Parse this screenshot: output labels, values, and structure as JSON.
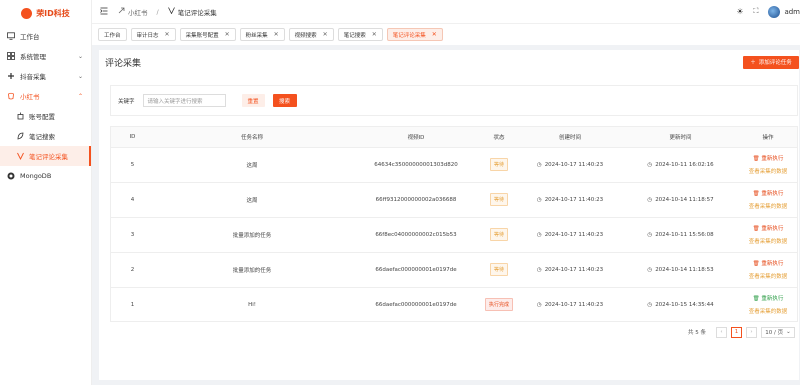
{
  "app": {
    "logo_text": "荣ID科技"
  },
  "sidebar": {
    "items": [
      {
        "label": "工作台",
        "icon": "monitor-icon"
      },
      {
        "label": "系统管理",
        "icon": "grid-icon"
      },
      {
        "label": "抖音采集",
        "icon": "tiktok-icon"
      },
      {
        "label": "小红书",
        "icon": "redbook-icon"
      }
    ],
    "sub_items": [
      {
        "label": "账号配置"
      },
      {
        "label": "笔记搜索"
      },
      {
        "label": "笔记评论采集"
      }
    ],
    "mongo": {
      "label": "MongoDB"
    }
  },
  "header": {
    "breadcrumb": [
      "小红书",
      "笔记评论采集"
    ],
    "username": "adm"
  },
  "tags": [
    {
      "label": "工作台"
    },
    {
      "label": "审计日志"
    },
    {
      "label": "采集账号配置"
    },
    {
      "label": "粉丝采集"
    },
    {
      "label": "视频搜索"
    },
    {
      "label": "笔记搜索"
    },
    {
      "label": "笔记评论采集"
    }
  ],
  "page": {
    "title": "评论采集",
    "add_button": "添加评论任务",
    "search_label": "关键字",
    "search_placeholder": "请输入关键字进行搜索",
    "reset_button": "重置",
    "search_button": "搜索"
  },
  "table": {
    "headers": [
      "ID",
      "任务名称",
      "视频ID",
      "状态",
      "创建时间",
      "更新时间",
      "操作"
    ],
    "rows": [
      {
        "id": "5",
        "name": "这周",
        "video_id": "64634c35000000001303d820",
        "status": "等待",
        "created": "2024-10-17 11:40:23",
        "updated": "2024-10-11 16:02:16",
        "op1": "重新执行",
        "op2": "查看采集的数据"
      },
      {
        "id": "4",
        "name": "这周",
        "video_id": "66ff9312000000002a036688",
        "status": "等待",
        "created": "2024-10-17 11:40:23",
        "updated": "2024-10-14 11:18:57",
        "op1": "重新执行",
        "op2": "查看采集的数据"
      },
      {
        "id": "3",
        "name": "批量添加的任务",
        "video_id": "66f8ec04000000002c015b53",
        "status": "等待",
        "created": "2024-10-17 11:40:23",
        "updated": "2024-10-11 15:56:08",
        "op1": "重新执行",
        "op2": "查看采集的数据"
      },
      {
        "id": "2",
        "name": "批量添加的任务",
        "video_id": "66daefac000000001e0197de",
        "status": "等待",
        "created": "2024-10-17 11:40:23",
        "updated": "2024-10-14 11:18:53",
        "op1": "重新执行",
        "op2": "查看采集的数据"
      },
      {
        "id": "1",
        "name": "Hi!",
        "video_id": "66daefac000000001e0197de",
        "status": "执行完成",
        "created": "2024-10-17 11:40:23",
        "updated": "2024-10-15 14:35:44",
        "op1": "重新执行",
        "op2": "查看采集的数据"
      }
    ]
  },
  "pagination": {
    "total_text": "共 5 条",
    "current_page": "1",
    "page_size": "10 / 页"
  },
  "colors": {
    "accent": "#f4511e",
    "wait": "#e6a23c",
    "rerun_done": "#2e9e48"
  }
}
